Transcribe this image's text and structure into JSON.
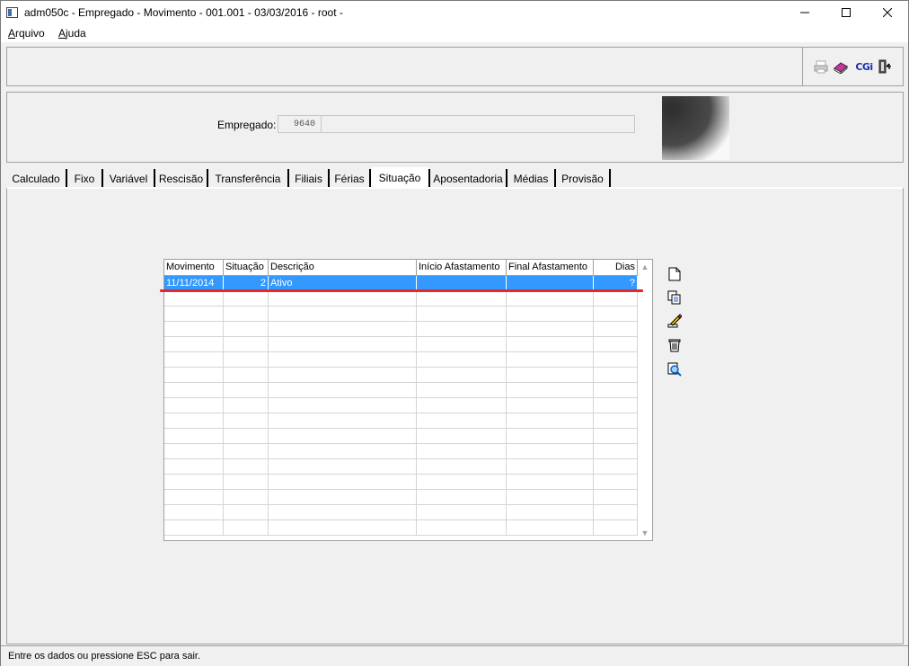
{
  "window": {
    "title": "adm050c - Empregado - Movimento - 001.001 - 03/03/2016 - root -"
  },
  "menu": {
    "items": [
      "Arquivo",
      "Ajuda"
    ]
  },
  "toolbar": {
    "icons": [
      "printer-icon",
      "book-icon",
      "cgi-icon",
      "exit-door-icon"
    ],
    "cgi_label": "CGi"
  },
  "employee": {
    "label": "Empregado:",
    "code": "9640",
    "name": ""
  },
  "tabs": [
    "Calculado",
    "Fixo",
    "Variável",
    "Rescisão",
    "Transferência",
    "Filiais",
    "Férias",
    "Situação",
    "Aposentadoria",
    "Médias",
    "Provisão"
  ],
  "active_tab": "Situação",
  "grid": {
    "columns": [
      "Movimento",
      "Situação",
      "Descrição",
      "Início Afastamento",
      "Final Afastamento",
      "Dias"
    ],
    "rows": [
      {
        "movimento": "11/11/2014",
        "situacao": "2",
        "descricao": "Ativo",
        "inicio": "",
        "final": "",
        "dias": "?"
      }
    ]
  },
  "side_actions": [
    "new-document-icon",
    "copy-icon",
    "edit-pencil-icon",
    "delete-trash-icon",
    "search-magnifier-icon"
  ],
  "status": {
    "text": "Entre os dados ou pressione ESC para sair."
  },
  "colors": {
    "selection": "#3399ff",
    "annotation_line": "#e8262b"
  }
}
